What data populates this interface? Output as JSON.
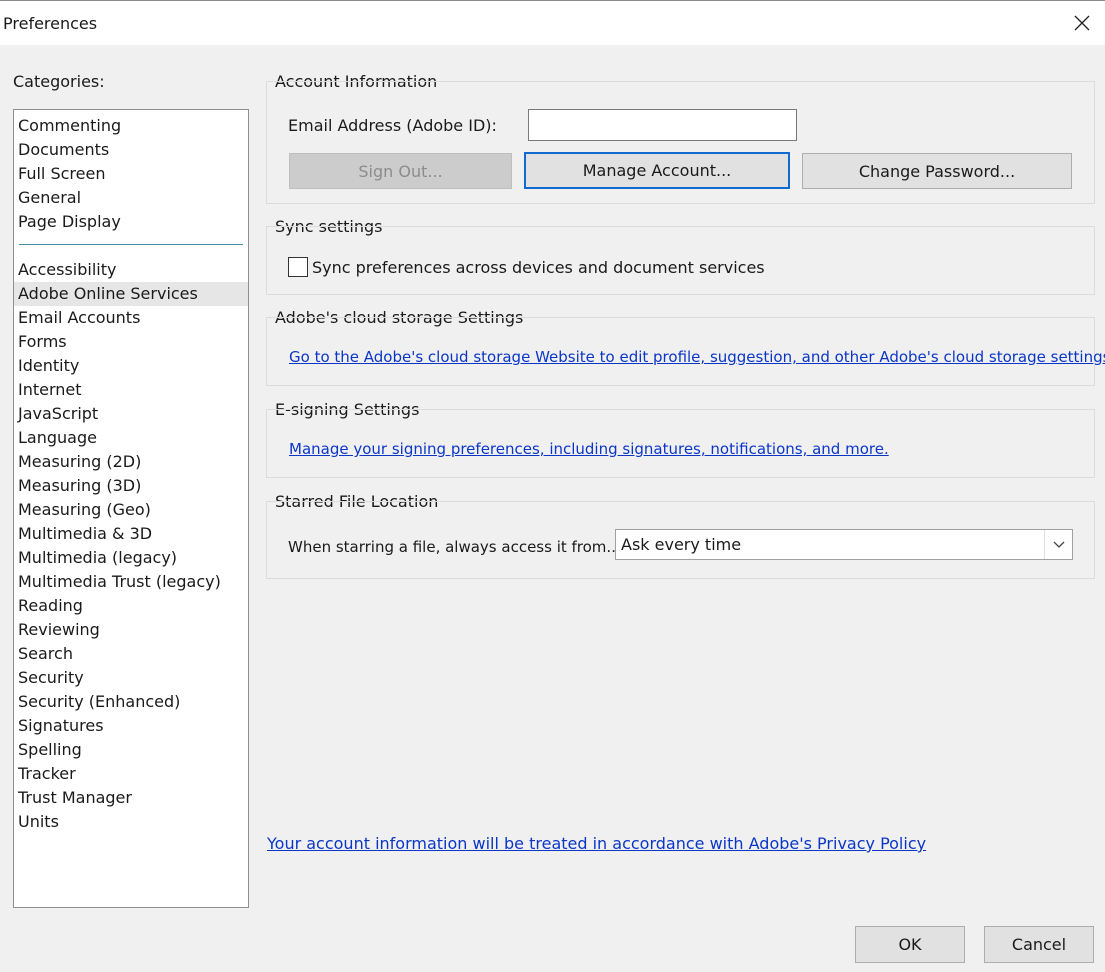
{
  "window": {
    "title": "Preferences"
  },
  "categories": {
    "label": "Categories:",
    "top_items": [
      "Commenting",
      "Documents",
      "Full Screen",
      "General",
      "Page Display"
    ],
    "items": [
      "Accessibility",
      "Adobe Online Services",
      "Email Accounts",
      "Forms",
      "Identity",
      "Internet",
      "JavaScript",
      "Language",
      "Measuring (2D)",
      "Measuring (3D)",
      "Measuring (Geo)",
      "Multimedia & 3D",
      "Multimedia (legacy)",
      "Multimedia Trust (legacy)",
      "Reading",
      "Reviewing",
      "Search",
      "Security",
      "Security (Enhanced)",
      "Signatures",
      "Spelling",
      "Tracker",
      "Trust Manager",
      "Units"
    ],
    "selected": "Adobe Online Services"
  },
  "account": {
    "heading": "Account Information",
    "email_label": "Email Address (Adobe ID):",
    "email_value": "",
    "sign_out": "Sign Out...",
    "manage": "Manage Account...",
    "change_password": "Change Password..."
  },
  "sync": {
    "heading": "Sync settings",
    "checkbox_label": "Sync preferences across devices and document services",
    "checked": false
  },
  "cloud": {
    "heading": "Adobe's cloud storage Settings",
    "link": "Go to the Adobe's cloud storage Website to edit profile, suggestion, and other Adobe's cloud storage settings."
  },
  "esign": {
    "heading": "E-signing Settings",
    "link": "Manage your signing preferences, including signatures, notifications, and more."
  },
  "starred": {
    "heading": "Starred File Location",
    "label": "When starring a file, always access it from...",
    "selected_option": "Ask every time"
  },
  "privacy_link": "Your account information will be treated in accordance with Adobe's Privacy Policy",
  "footer": {
    "ok": "OK",
    "cancel": "Cancel"
  },
  "colors": {
    "link": "#0a36c8",
    "focus": "#0f6bd0",
    "separator": "#3f8fa0"
  }
}
